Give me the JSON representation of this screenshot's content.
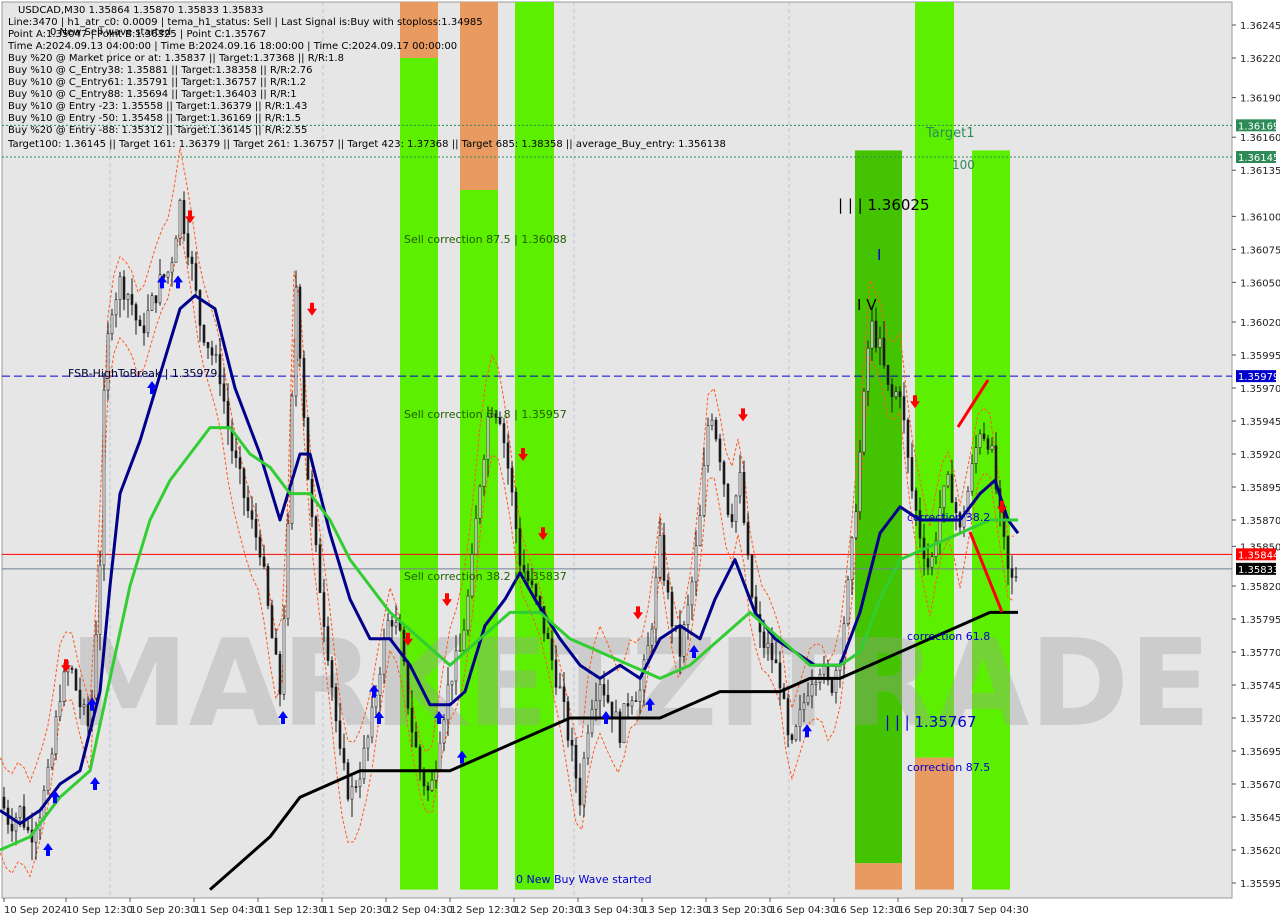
{
  "colors": {
    "background": "#ffffff",
    "plot_bg": "#e6e6e6",
    "green_zone": "#5cf000",
    "green_zone_dark": "#44c400",
    "orange_zone": "#e89a60",
    "candle": "#1b1b1b",
    "ma_fast": "#00008b",
    "ma_mid": "#32cd32",
    "ma_slow": "#000000",
    "envelope": "#ff5a1f",
    "buy_arrow": "#0000ff",
    "sell_arrow": "#ff0000",
    "fsb_line": "#0000cd",
    "current_price_line": "#ff0000",
    "bid_line": "#708090",
    "target_line": "#2e8b57",
    "zone_text": "#1f5e00"
  },
  "header": {
    "lines": [
      "USDCAD,M30  1.35864 1.35870 1.35833 1.35833",
      "Line:3470 | h1_atr_c0: 0.0009 | tema_h1_status: Sell | Last Signal is:Buy with stoploss:1.34985",
      "Point A:1.35047 | Point B:1.36325 | Point C:1.35767",
      "Time A:2024.09.13 04:00:00 | Time B:2024.09.16 18:00:00 | Time C:2024.09.17 00:00:00",
      "Buy %20 @ Market price or at: 1.35837 || Target:1.37368 || R/R:1.8",
      "Buy %10 @ C_Entry38: 1.35881 || Target:1.38358 || R/R:2.76",
      "Buy %10 @ C_Entry61: 1.35791 || Target:1.36757 || R/R:1.2",
      "Buy %10 @ C_Entry88: 1.35694 || Target:1.36403 || R/R:1",
      "Buy %10 @ Entry -23: 1.35558 || Target:1.36379 || R/R:1.43",
      "Buy %10 @ Entry -50: 1.35458 || Target:1.36169 || R/R:1.5",
      "Buy %20 @ Entry -88: 1.35312 || Target:1.36145 || R/R:2.55",
      "Target100: 1.36145 || Target 161: 1.36379 || Target 261: 1.36757 || Target 423: 1.37368 || Target 685: 1.38358 || average_Buy_entry: 1.356138"
    ],
    "overlay": "0 New Sell wave started"
  },
  "annotations": {
    "sell_corr_875": "Sell correction 87.5 | 1.36088",
    "sell_corr_618": "Sell correction 61.8 | 1.35957",
    "sell_corr_382": "Sell correction 38.2 | 1.35837",
    "fsb": "FSB-HighToBreak | 1.35979",
    "new_buy": "0 New Buy Wave started",
    "target1": "Target1",
    "hundred": "100",
    "wave_high": "| | | 1.36025",
    "wave_iv": "I V",
    "wave_i": "I",
    "corr_382": "correction 38.2",
    "corr_618": "correction 61.8",
    "corr_875": "correction 87.5",
    "wave_low": "| | | 1.35767",
    "watermark": "MARKETZITRADE"
  },
  "chart_data": {
    "type": "candlestick",
    "symbol": "USDCAD",
    "timeframe": "M30",
    "ylim": [
      1.35588,
      1.36659
    ],
    "y_ticks": [
      1.36245,
      1.3622,
      1.3619,
      1.3616,
      1.36135,
      1.361,
      1.36075,
      1.3605,
      1.3602,
      1.35995,
      1.3597,
      1.35945,
      1.3592,
      1.35895,
      1.3587,
      1.3585,
      1.3582,
      1.35795,
      1.3577,
      1.35745,
      1.3572,
      1.35695,
      1.3567,
      1.35645,
      1.3562,
      1.35595
    ],
    "x_ticks": [
      "10 Sep 2024",
      "10 Sep 12:30",
      "10 Sep 20:30",
      "11 Sep 04:30",
      "11 Sep 12:30",
      "11 Sep 20:30",
      "12 Sep 04:30",
      "12 Sep 12:30",
      "12 Sep 20:30",
      "13 Sep 04:30",
      "13 Sep 12:30",
      "13 Sep 20:30",
      "16 Sep 04:30",
      "16 Sep 12:30",
      "16 Sep 20:30",
      "17 Sep 04:30"
    ],
    "price_labels": [
      {
        "label": "1.36169",
        "value": 1.36169,
        "kind": "target"
      },
      {
        "label": "1.36145",
        "value": 1.36145,
        "kind": "target"
      },
      {
        "label": "1.35979",
        "value": 1.35979,
        "kind": "fsb"
      },
      {
        "label": "1.35844",
        "value": 1.35844,
        "kind": "current"
      },
      {
        "label": "1.35833",
        "value": 1.35833,
        "kind": "bid"
      }
    ],
    "ohlc": {
      "open": 1.35864,
      "high": 1.3587,
      "low": 1.35833,
      "close": 1.35833
    },
    "close_path": [
      [
        0,
        1.3566
      ],
      [
        10,
        1.3564
      ],
      [
        20,
        1.3565
      ],
      [
        30,
        1.3563
      ],
      [
        40,
        1.3565
      ],
      [
        50,
        1.3568
      ],
      [
        60,
        1.3574
      ],
      [
        70,
        1.3576
      ],
      [
        80,
        1.3573
      ],
      [
        90,
        1.3571
      ],
      [
        100,
        1.3584
      ],
      [
        104,
        1.3596
      ],
      [
        110,
        1.3603
      ],
      [
        120,
        1.3605
      ],
      [
        130,
        1.3604
      ],
      [
        140,
        1.3601
      ],
      [
        150,
        1.3603
      ],
      [
        160,
        1.3605
      ],
      [
        170,
        1.3606
      ],
      [
        180,
        1.3611
      ],
      [
        190,
        1.3607
      ],
      [
        200,
        1.3602
      ],
      [
        210,
        1.36
      ],
      [
        220,
        1.3598
      ],
      [
        230,
        1.3593
      ],
      [
        240,
        1.359
      ],
      [
        250,
        1.3587
      ],
      [
        260,
        1.3585
      ],
      [
        270,
        1.3579
      ],
      [
        280,
        1.3574
      ],
      [
        290,
        1.3589
      ],
      [
        295,
        1.3606
      ],
      [
        300,
        1.36
      ],
      [
        310,
        1.3588
      ],
      [
        320,
        1.3582
      ],
      [
        330,
        1.3576
      ],
      [
        340,
        1.3569
      ],
      [
        350,
        1.3566
      ],
      [
        360,
        1.3568
      ],
      [
        370,
        1.3571
      ],
      [
        380,
        1.3576
      ],
      [
        390,
        1.358
      ],
      [
        400,
        1.3578
      ],
      [
        410,
        1.3572
      ],
      [
        420,
        1.3568
      ],
      [
        430,
        1.3566
      ],
      [
        440,
        1.3571
      ],
      [
        450,
        1.3575
      ],
      [
        460,
        1.3577
      ],
      [
        470,
        1.3582
      ],
      [
        480,
        1.359
      ],
      [
        490,
        1.3596
      ],
      [
        500,
        1.3595
      ],
      [
        510,
        1.359
      ],
      [
        520,
        1.3584
      ],
      [
        530,
        1.3582
      ],
      [
        540,
        1.358
      ],
      [
        550,
        1.3577
      ],
      [
        560,
        1.3574
      ],
      [
        570,
        1.357
      ],
      [
        580,
        1.3566
      ],
      [
        590,
        1.3573
      ],
      [
        600,
        1.3575
      ],
      [
        610,
        1.3573
      ],
      [
        620,
        1.3571
      ],
      [
        630,
        1.3574
      ],
      [
        640,
        1.3574
      ],
      [
        650,
        1.3578
      ],
      [
        660,
        1.3585
      ],
      [
        670,
        1.358
      ],
      [
        680,
        1.3577
      ],
      [
        690,
        1.3581
      ],
      [
        700,
        1.3587
      ],
      [
        710,
        1.3596
      ],
      [
        720,
        1.3592
      ],
      [
        730,
        1.3587
      ],
      [
        740,
        1.359
      ],
      [
        750,
        1.3582
      ],
      [
        760,
        1.3578
      ],
      [
        770,
        1.3577
      ],
      [
        780,
        1.3575
      ],
      [
        790,
        1.3569
      ],
      [
        800,
        1.3572
      ],
      [
        810,
        1.3575
      ],
      [
        820,
        1.3576
      ],
      [
        830,
        1.3574
      ],
      [
        840,
        1.3577
      ],
      [
        850,
        1.3583
      ],
      [
        860,
        1.3592
      ],
      [
        870,
        1.3602
      ],
      [
        880,
        1.36
      ],
      [
        890,
        1.3596
      ],
      [
        900,
        1.3597
      ],
      [
        910,
        1.359
      ],
      [
        920,
        1.3586
      ],
      [
        930,
        1.3583
      ],
      [
        940,
        1.3588
      ],
      [
        950,
        1.359
      ],
      [
        960,
        1.3586
      ],
      [
        970,
        1.359
      ],
      [
        980,
        1.3594
      ],
      [
        990,
        1.3593
      ],
      [
        1000,
        1.3587
      ],
      [
        1010,
        1.3582
      ],
      [
        1018,
        1.35833
      ]
    ],
    "series": [
      {
        "role": "ma_fast",
        "points": [
          [
            0,
            1.3565
          ],
          [
            20,
            1.3564
          ],
          [
            40,
            1.3565
          ],
          [
            60,
            1.3567
          ],
          [
            80,
            1.3568
          ],
          [
            100,
            1.3574
          ],
          [
            110,
            1.3582
          ],
          [
            120,
            1.3589
          ],
          [
            140,
            1.3593
          ],
          [
            160,
            1.3598
          ],
          [
            180,
            1.3603
          ],
          [
            195,
            1.3604
          ],
          [
            215,
            1.3603
          ],
          [
            235,
            1.3597
          ],
          [
            260,
            1.3592
          ],
          [
            280,
            1.3587
          ],
          [
            300,
            1.3592
          ],
          [
            310,
            1.3592
          ],
          [
            330,
            1.3586
          ],
          [
            350,
            1.3581
          ],
          [
            370,
            1.3578
          ],
          [
            390,
            1.3578
          ],
          [
            410,
            1.3576
          ],
          [
            430,
            1.3573
          ],
          [
            450,
            1.3573
          ],
          [
            465,
            1.3574
          ],
          [
            485,
            1.3579
          ],
          [
            505,
            1.3581
          ],
          [
            520,
            1.3583
          ],
          [
            535,
            1.3581
          ],
          [
            560,
            1.3578
          ],
          [
            580,
            1.3576
          ],
          [
            600,
            1.3575
          ],
          [
            620,
            1.3576
          ],
          [
            640,
            1.3575
          ],
          [
            660,
            1.3578
          ],
          [
            680,
            1.3579
          ],
          [
            700,
            1.3578
          ],
          [
            715,
            1.3581
          ],
          [
            735,
            1.3584
          ],
          [
            755,
            1.358
          ],
          [
            775,
            1.3578
          ],
          [
            795,
            1.3577
          ],
          [
            815,
            1.3576
          ],
          [
            840,
            1.3576
          ],
          [
            860,
            1.358
          ],
          [
            880,
            1.3586
          ],
          [
            900,
            1.3588
          ],
          [
            920,
            1.3587
          ],
          [
            940,
            1.3587
          ],
          [
            960,
            1.3587
          ],
          [
            980,
            1.3589
          ],
          [
            995,
            1.359
          ],
          [
            1008,
            1.3587
          ],
          [
            1018,
            1.3586
          ]
        ]
      },
      {
        "role": "ma_mid",
        "points": [
          [
            0,
            1.3562
          ],
          [
            30,
            1.3563
          ],
          [
            60,
            1.3566
          ],
          [
            90,
            1.3568
          ],
          [
            110,
            1.3575
          ],
          [
            130,
            1.3582
          ],
          [
            150,
            1.3587
          ],
          [
            170,
            1.359
          ],
          [
            190,
            1.3592
          ],
          [
            210,
            1.3594
          ],
          [
            230,
            1.3594
          ],
          [
            250,
            1.3592
          ],
          [
            270,
            1.3591
          ],
          [
            290,
            1.3589
          ],
          [
            310,
            1.3589
          ],
          [
            330,
            1.3587
          ],
          [
            350,
            1.3584
          ],
          [
            370,
            1.3582
          ],
          [
            390,
            1.358
          ],
          [
            420,
            1.3578
          ],
          [
            450,
            1.3576
          ],
          [
            480,
            1.3578
          ],
          [
            510,
            1.358
          ],
          [
            540,
            1.358
          ],
          [
            570,
            1.3578
          ],
          [
            600,
            1.3577
          ],
          [
            630,
            1.3576
          ],
          [
            660,
            1.3575
          ],
          [
            690,
            1.3576
          ],
          [
            720,
            1.3578
          ],
          [
            750,
            1.358
          ],
          [
            780,
            1.3578
          ],
          [
            810,
            1.3576
          ],
          [
            840,
            1.3576
          ],
          [
            860,
            1.3577
          ],
          [
            880,
            1.3581
          ],
          [
            900,
            1.3584
          ],
          [
            930,
            1.3585
          ],
          [
            960,
            1.3586
          ],
          [
            990,
            1.3587
          ],
          [
            1018,
            1.3587
          ]
        ]
      },
      {
        "role": "ma_slow",
        "points": [
          [
            210,
            1.3559
          ],
          [
            240,
            1.3561
          ],
          [
            270,
            1.3563
          ],
          [
            300,
            1.3566
          ],
          [
            330,
            1.3567
          ],
          [
            360,
            1.3568
          ],
          [
            390,
            1.3568
          ],
          [
            420,
            1.3568
          ],
          [
            450,
            1.3568
          ],
          [
            480,
            1.3569
          ],
          [
            510,
            1.357
          ],
          [
            540,
            1.3571
          ],
          [
            570,
            1.3572
          ],
          [
            600,
            1.3572
          ],
          [
            630,
            1.3572
          ],
          [
            660,
            1.3572
          ],
          [
            690,
            1.3573
          ],
          [
            720,
            1.3574
          ],
          [
            750,
            1.3574
          ],
          [
            780,
            1.3574
          ],
          [
            810,
            1.3575
          ],
          [
            840,
            1.3575
          ],
          [
            870,
            1.3576
          ],
          [
            900,
            1.3577
          ],
          [
            930,
            1.3578
          ],
          [
            960,
            1.3579
          ],
          [
            990,
            1.358
          ],
          [
            1018,
            1.358
          ]
        ]
      }
    ],
    "zones": [
      {
        "kind": "green",
        "x": [
          400,
          438
        ],
        "y": [
          1.3559,
          1.3622
        ]
      },
      {
        "kind": "orange",
        "x": [
          400,
          438
        ],
        "y": [
          1.3622,
          1.3666
        ]
      },
      {
        "kind": "green",
        "x": [
          460,
          498
        ],
        "y": [
          1.3559,
          1.3612
        ]
      },
      {
        "kind": "orange",
        "x": [
          460,
          498
        ],
        "y": [
          1.3612,
          1.3666
        ]
      },
      {
        "kind": "green",
        "x": [
          515,
          554
        ],
        "y": [
          1.3559,
          1.3666
        ]
      },
      {
        "kind": "green_dark",
        "x": [
          855,
          902
        ],
        "y": [
          1.3561,
          1.3615
        ]
      },
      {
        "kind": "orange",
        "x": [
          855,
          902
        ],
        "y": [
          1.3559,
          1.3561
        ]
      },
      {
        "kind": "green",
        "x": [
          915,
          954
        ],
        "y": [
          1.3569,
          1.3666
        ]
      },
      {
        "kind": "orange",
        "x": [
          915,
          954
        ],
        "y": [
          1.3559,
          1.3569
        ]
      },
      {
        "kind": "green",
        "x": [
          972,
          1010
        ],
        "y": [
          1.3559,
          1.3615
        ]
      }
    ],
    "buy_arrows": [
      [
        48,
        1.3562
      ],
      [
        55,
        1.3566
      ],
      [
        95,
        1.3567
      ],
      [
        92,
        1.3573
      ],
      [
        152,
        1.3597
      ],
      [
        162,
        1.3605
      ],
      [
        178,
        1.3605
      ],
      [
        283,
        1.3572
      ],
      [
        374,
        1.3574
      ],
      [
        379,
        1.3572
      ],
      [
        439,
        1.3572
      ],
      [
        462,
        1.3569
      ],
      [
        606,
        1.3572
      ],
      [
        650,
        1.3573
      ],
      [
        694,
        1.3577
      ],
      [
        807,
        1.3571
      ]
    ],
    "sell_arrows": [
      [
        66,
        1.3576
      ],
      [
        190,
        1.361
      ],
      [
        312,
        1.3603
      ],
      [
        408,
        1.3578
      ],
      [
        447,
        1.3581
      ],
      [
        523,
        1.3592
      ],
      [
        543,
        1.3586
      ],
      [
        638,
        1.358
      ],
      [
        743,
        1.3595
      ],
      [
        915,
        1.3596
      ],
      [
        1002,
        1.3588
      ]
    ]
  }
}
